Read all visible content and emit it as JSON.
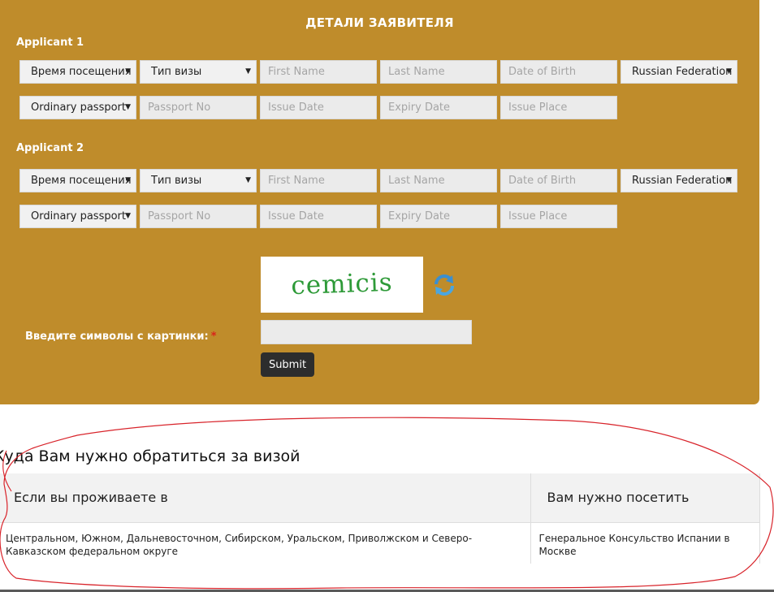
{
  "form": {
    "title": "ДЕТАЛИ ЗАЯВИТЕЛЯ",
    "applicants": [
      {
        "label": "Applicant 1",
        "visit_time": "Время посещения",
        "visa_type": "Тип визы",
        "first_name_placeholder": "First Name",
        "last_name_placeholder": "Last Name",
        "dob_placeholder": "Date of Birth",
        "nationality": "Russian Federation",
        "passport_type": "Ordinary passport",
        "passport_no_placeholder": "Passport No",
        "issue_date_placeholder": "Issue Date",
        "expiry_date_placeholder": "Expiry Date",
        "issue_place_placeholder": "Issue Place"
      },
      {
        "label": "Applicant 2",
        "visit_time": "Время посещения",
        "visa_type": "Тип визы",
        "first_name_placeholder": "First Name",
        "last_name_placeholder": "Last Name",
        "dob_placeholder": "Date of Birth",
        "nationality": "Russian Federation",
        "passport_type": "Ordinary passport",
        "passport_no_placeholder": "Passport No",
        "issue_date_placeholder": "Issue Date",
        "expiry_date_placeholder": "Expiry Date",
        "issue_place_placeholder": "Issue Place"
      }
    ],
    "captcha": {
      "image_text": "cemicis",
      "label": "Введите символы с картинки:",
      "required_mark": "*",
      "refresh_icon": "refresh-icon"
    },
    "submit_label": "Submit"
  },
  "info": {
    "heading": "Куда Вам нужно обратиться за визой",
    "headers": [
      "Если вы проживаете в",
      "Вам нужно посетить"
    ],
    "rows": [
      [
        "Центральном, Южном, Дальневосточном, Сибирском, Уральском, Приволжском и Северо-Кавказском федеральном округе",
        "Генеральное Консульство Испании в Москве"
      ]
    ]
  },
  "colors": {
    "panel": "#bf8c2b",
    "submit": "#2d2d2d",
    "captcha_text": "#2e9a38",
    "annotation": "#d8232a"
  }
}
